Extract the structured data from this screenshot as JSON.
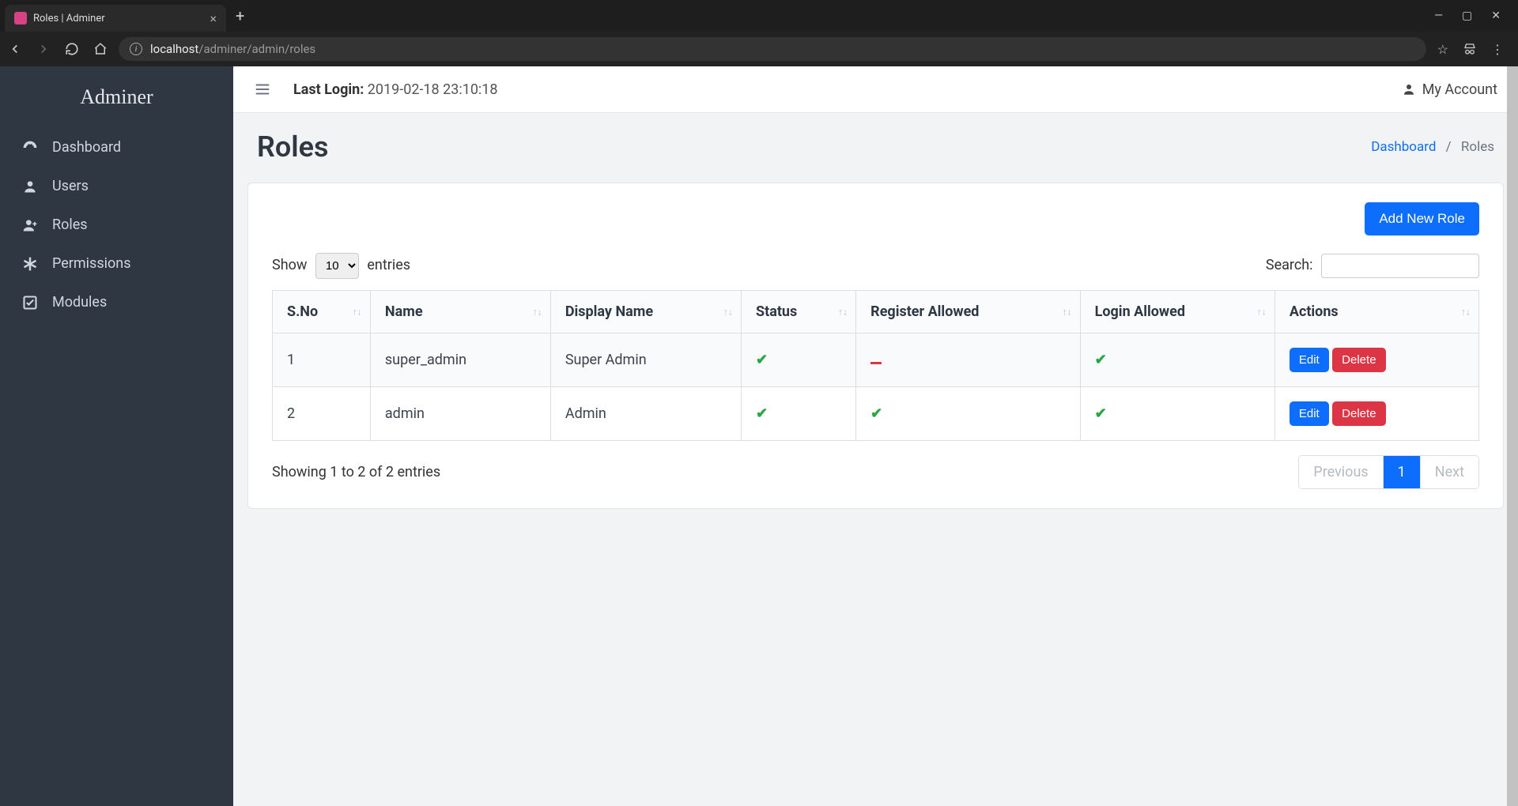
{
  "browser": {
    "tab_title": "Roles | Adminer",
    "url_domain": "localhost",
    "url_path": "/adminer/admin/roles"
  },
  "sidebar": {
    "brand": "Adminer",
    "items": [
      {
        "label": "Dashboard"
      },
      {
        "label": "Users"
      },
      {
        "label": "Roles"
      },
      {
        "label": "Permissions"
      },
      {
        "label": "Modules"
      }
    ]
  },
  "topbar": {
    "last_login_label": "Last Login:",
    "last_login_value": "2019-02-18 23:10:18",
    "my_account": "My Account"
  },
  "page": {
    "title": "Roles",
    "breadcrumb_dashboard": "Dashboard",
    "breadcrumb_current": "Roles"
  },
  "card": {
    "add_button": "Add New Role",
    "show_label_pre": "Show",
    "show_value": "10",
    "show_label_post": "entries",
    "search_label": "Search:",
    "columns": {
      "sno": "S.No",
      "name": "Name",
      "display_name": "Display Name",
      "status": "Status",
      "register_allowed": "Register Allowed",
      "login_allowed": "Login Allowed",
      "actions": "Actions"
    },
    "rows": [
      {
        "sno": "1",
        "name": "super_admin",
        "display_name": "Super Admin",
        "status": true,
        "register_allowed": false,
        "login_allowed": true
      },
      {
        "sno": "2",
        "name": "admin",
        "display_name": "Admin",
        "status": true,
        "register_allowed": true,
        "login_allowed": true
      }
    ],
    "edit_label": "Edit",
    "delete_label": "Delete",
    "footer_info": "Showing 1 to 2 of 2 entries",
    "prev": "Previous",
    "page_num": "1",
    "next": "Next"
  }
}
